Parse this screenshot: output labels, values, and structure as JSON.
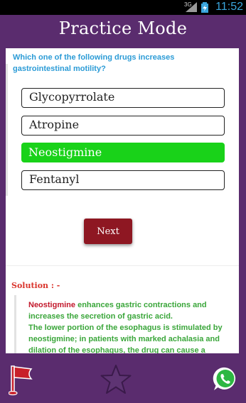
{
  "status_bar": {
    "network": "3G",
    "time": "11:52"
  },
  "header": {
    "title": "Practice Mode"
  },
  "question": {
    "text": "Which one of the following drugs increases gastrointestinal motility?"
  },
  "options": [
    {
      "label": "Glycopyrrolate",
      "selected": false
    },
    {
      "label": "Atropine",
      "selected": false
    },
    {
      "label": "Neostigmine",
      "selected": true
    },
    {
      "label": "Fentanyl",
      "selected": false
    }
  ],
  "next_label": "Next",
  "solution": {
    "title": "Solution : -",
    "drug": "Neostigmine",
    "line1_rest": " enhances gastric contractions and increases the secretion of gastric acid.",
    "line2": "The lower portion of the esophagus is stimulated by neostigmine; in patients with marked achalasia and dilation of the esophagus, the drug can cause a"
  },
  "bottom_bar": {
    "flag_icon": "flag-icon",
    "star_icon": "star-icon",
    "share_icon": "whatsapp-icon"
  },
  "colors": {
    "primary": "#5a2c6e",
    "question": "#2b9bd6",
    "selected_option": "#19d219",
    "next_button": "#8e1722",
    "solution_title": "#d9332b",
    "solution_text": "#3aa63a",
    "solution_drug": "#c2182b"
  }
}
